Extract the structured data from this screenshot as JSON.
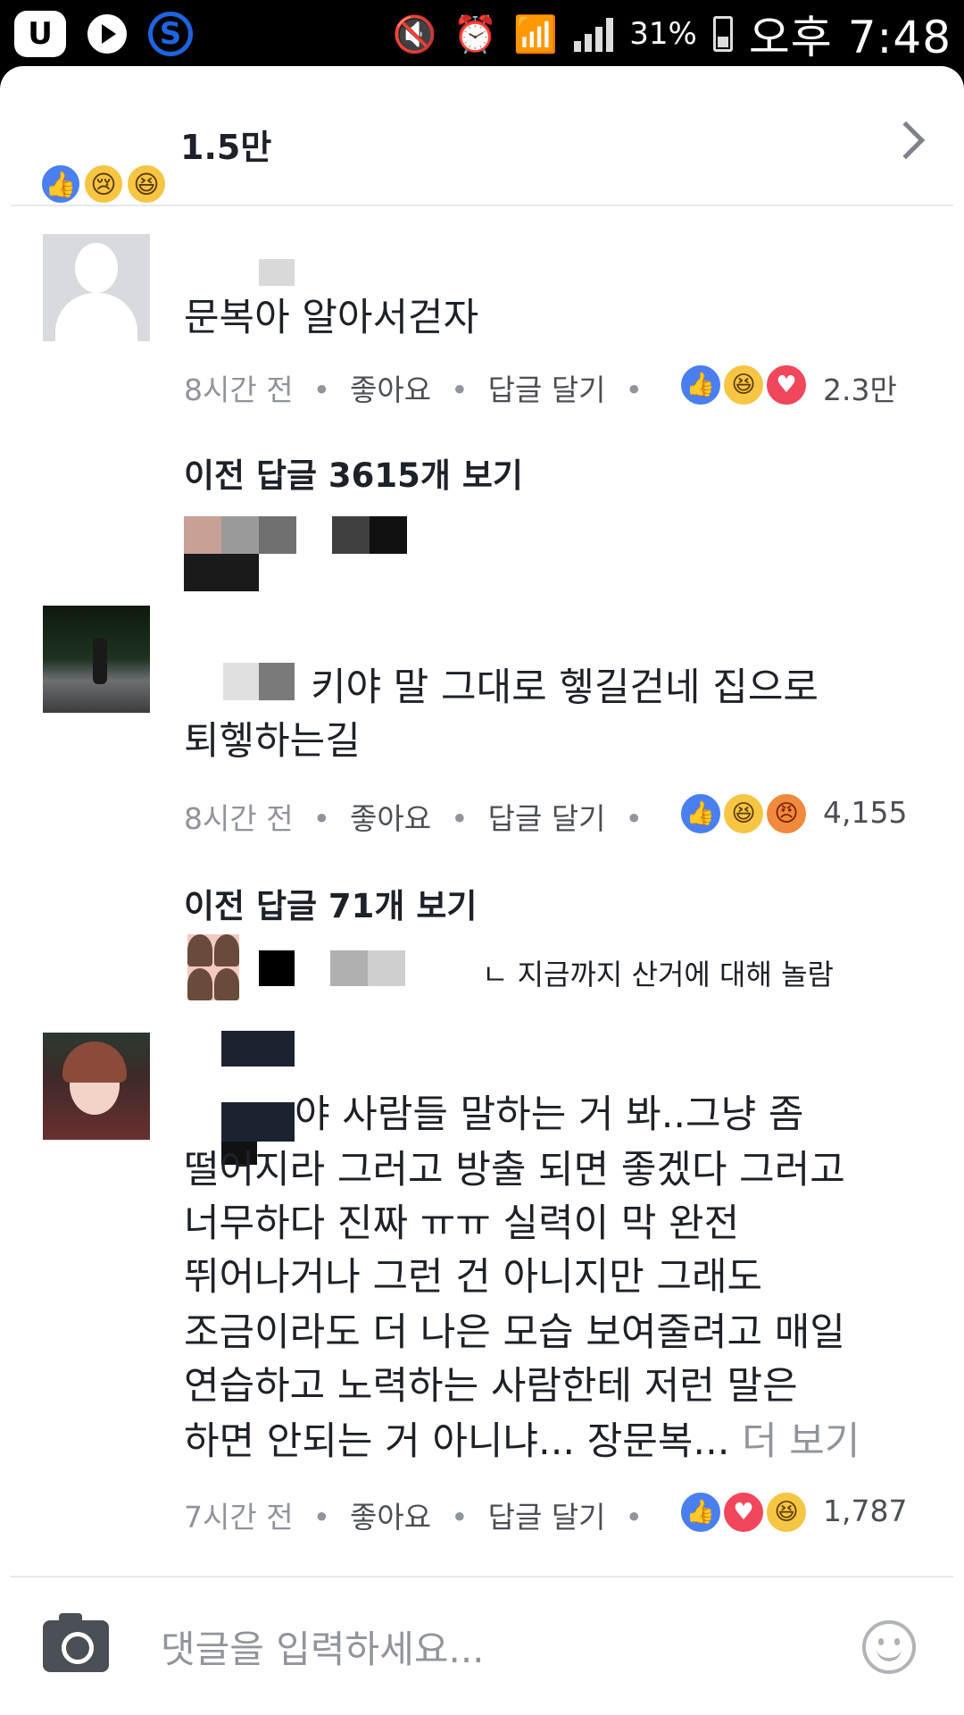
{
  "status_bar": {
    "battery": "31%",
    "ampm": "오후",
    "time": "7:48",
    "icons": [
      "uplus-app-icon",
      "play-icon",
      "s-app-icon",
      "mute-vibrate-icon",
      "alarm-icon",
      "wifi-icon",
      "signal-icon",
      "battery-icon"
    ]
  },
  "header": {
    "reactions": [
      "like",
      "sad",
      "haha"
    ],
    "count": "1.5만"
  },
  "comments": [
    {
      "text": "문복아 알아서걷자",
      "time": "8시간 전",
      "like_label": "좋아요",
      "reply_label": "답글 달기",
      "reactions": [
        "like",
        "haha",
        "love"
      ],
      "reaction_count": "2.3만",
      "view_replies": "이전 답글 3615개 보기"
    },
    {
      "text_line1": "키야 말 그대로 헿길걷네 집으로",
      "text_line2": "퇴헿하는길",
      "time": "8시간 전",
      "like_label": "좋아요",
      "reply_label": "답글 달기",
      "reactions": [
        "like",
        "haha",
        "angry"
      ],
      "reaction_count": "4,155",
      "view_replies": "이전 답글 71개 보기",
      "reply_preview": "ㄴ 지금까지 산거에 대해 놀람"
    },
    {
      "lines": [
        "야 사람들 말하는 거 봐..그냥 좀",
        "떨어지라 그러고 방출 되면 좋겠다 그러고",
        "너무하다 진짜 ㅠㅠ 실력이 막 완전",
        "뛰어나거나 그런 건 아니지만 그래도",
        "조금이라도 더 나은 모습 보여줄려고 매일",
        "연습하고 노력하는 사람한테 저런 말은",
        "하면 안되는 거 아니냐... 장문복..."
      ],
      "see_more": "더 보기",
      "time": "7시간 전",
      "like_label": "좋아요",
      "reply_label": "답글 달기",
      "reactions": [
        "like",
        "love",
        "haha"
      ],
      "reaction_count": "1,787"
    }
  ],
  "composer": {
    "placeholder": "댓글을 입력하세요..."
  },
  "colors": {
    "like": "#4a7ff0",
    "love": "#f0475c",
    "haha": "#f6c544",
    "angry": "#f08a3c",
    "text": "#1d2129",
    "meta": "#90949c"
  }
}
